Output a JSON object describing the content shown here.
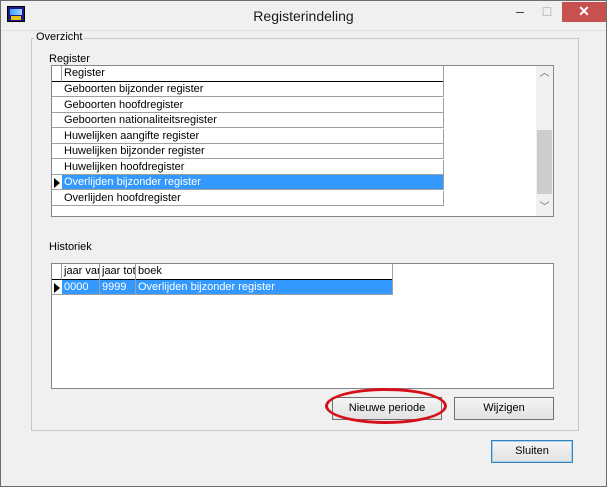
{
  "window": {
    "title": "Registerindeling"
  },
  "titlebar_buttons": {
    "minimize": "–",
    "maximize": "□",
    "close": "✕"
  },
  "overview": {
    "legend": "Overzicht",
    "register_label": "Register",
    "register_column": "Register",
    "registers": [
      "Geboorten bijzonder register",
      "Geboorten hoofdregister",
      "Geboorten nationaliteitsregister",
      "Huwelijken aangifte register",
      "Huwelijken bijzonder register",
      "Huwelijken hoofdregister",
      "Overlijden bijzonder register",
      "Overlijden hoofdregister"
    ],
    "selected_register_index": 6
  },
  "history": {
    "label": "Historiek",
    "columns": [
      "jaar van",
      "jaar tot",
      "boek"
    ],
    "rows": [
      {
        "from": "0000",
        "to": "9999",
        "book": "Overlijden bijzonder register"
      }
    ]
  },
  "buttons": {
    "new_period": "Nieuwe periode",
    "modify": "Wijzigen",
    "close": "Sluiten"
  },
  "colors": {
    "selection": "#3399ff",
    "highlight_ellipse": "#d6101a",
    "close_button": "#c75050"
  }
}
